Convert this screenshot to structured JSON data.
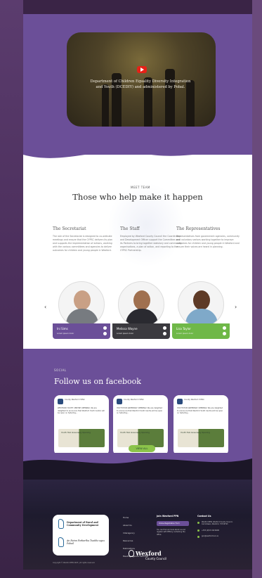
{
  "hero": {
    "video_caption": "Department of Children Equality Diversity Integration and Youth (DCEDIY) and administered by Pobal."
  },
  "team": {
    "tag": "MEET TEAM",
    "title": "Those who help make it happen",
    "roles": [
      {
        "title": "The Secretariat",
        "text": "The role of the Secretariat is designed to co-ordinate meetings and ensure that the CYPSC delivers its plan and supports the implementation of actions, working with the various committees and agencies to deliver outcomes for children and young people in Wexford."
      },
      {
        "title": "The Staff",
        "text": "Employed by Wexford County Council the Coordinator and Development Officer support the Committee and its Partners to bring together statutory and community organisations, a plan of action, and reporting to the CYPSC Partnership."
      },
      {
        "title": "The Representatives",
        "text": "Representatives from government agencies, community and voluntary sectors working together to improve outcomes for children and young people in Wexford and ensure their voices are heard in planning."
      }
    ],
    "members": [
      {
        "name": "Ini Sims",
        "subtitle": "Lorem ipsum dolor"
      },
      {
        "name": "Melissa Wayne",
        "subtitle": "Lorem ipsum dolor"
      },
      {
        "name": "Lisa Taylor",
        "subtitle": "Lorem ipsum dolor"
      }
    ],
    "prev_arrow": "‹",
    "next_arrow": "›"
  },
  "facebook": {
    "tag": "SOCIAL",
    "title": "Follow us on facebook",
    "posts": [
      {
        "header": "County Wexford CYPSC",
        "text": "WEXFORD YOUTH CENTRE OPENING! We are delighted to announce that Wexford Youth Centre will be open on Saturday...",
        "image_text": "Youth Hub Greenway Opening"
      },
      {
        "header": "County Wexford CYPSC",
        "text": "YOUTH HUB GREENWAY OPENING! We are delighted to announce that Wexford Youth Centre will be open on Saturday...",
        "image_text": "Youth Hub Greenway Opening"
      },
      {
        "header": "County Wexford CYPSC",
        "text": "YOUTH HUB GREENWAY OPENING! We are delighted to announce that Wexford Youth Centre will be open on Saturday...",
        "image_text": "Youth Hub Greenway Opening"
      }
    ],
    "view_all": "VIEW ALL"
  },
  "footer": {
    "dept_en": "Department of Rural and Community Development",
    "dept_ga": "An Roinn Forbartha Tuaithe agus Pobail",
    "links": [
      "Home",
      "About Us",
      "Interagency",
      "Resources",
      "Publications",
      "Meeting Agenda Calendar"
    ],
    "join_title": "Join Wexford PPN",
    "join_button": "Online Registration Form",
    "join_text": "You can find out more about us and register with PPN by contacting the office.",
    "contact_title": "Contact Us",
    "contact_rows": [
      "Wexford PPN, Wexford County Council, Carricklawn, Wexford, Y35 WY93",
      "+353 (0)53 919 6000",
      "ppn@wexfordcoco.ie"
    ],
    "wexford_name": "Wexford",
    "wexford_sub": "County Council",
    "copyright": "Copyright © Wexford PPN 2023 | All rights reserved."
  }
}
